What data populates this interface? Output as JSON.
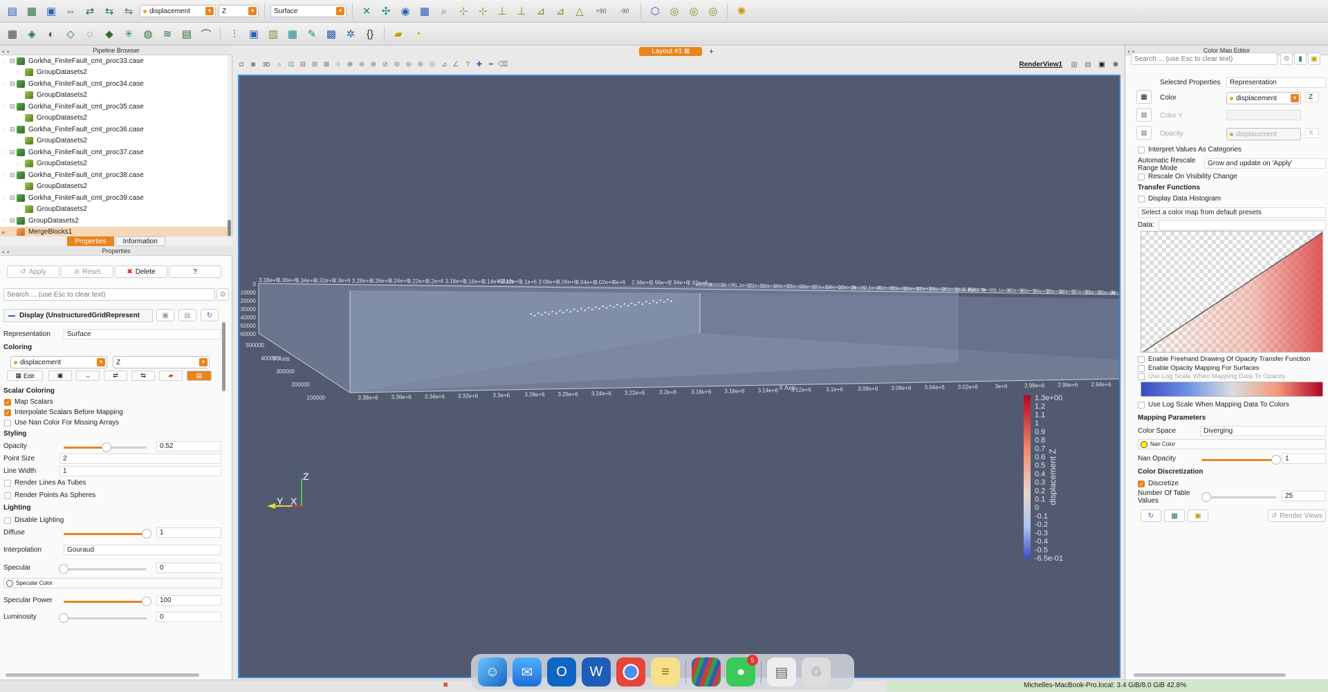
{
  "toolbar1": {
    "color_array": "displacement",
    "component": "Z",
    "representation": "Surface",
    "rot_plus": "+90",
    "rot_minus": "-90"
  },
  "pipeline": {
    "title": "Pipeline Browser",
    "items": [
      {
        "label": "Gorkha_FiniteFault_cmt_proc33.case",
        "kind": "case"
      },
      {
        "label": "GroupDatasets2",
        "kind": "group"
      },
      {
        "label": "Gorkha_FiniteFault_cmt_proc34.case",
        "kind": "case"
      },
      {
        "label": "GroupDatasets2",
        "kind": "group"
      },
      {
        "label": "Gorkha_FiniteFault_cmt_proc35.case",
        "kind": "case"
      },
      {
        "label": "GroupDatasets2",
        "kind": "group"
      },
      {
        "label": "Gorkha_FiniteFault_cmt_proc36.case",
        "kind": "case"
      },
      {
        "label": "GroupDatasets2",
        "kind": "group"
      },
      {
        "label": "Gorkha_FiniteFault_cmt_proc37.case",
        "kind": "case"
      },
      {
        "label": "GroupDatasets2",
        "kind": "group"
      },
      {
        "label": "Gorkha_FiniteFault_cmt_proc38.case",
        "kind": "case"
      },
      {
        "label": "GroupDatasets2",
        "kind": "group"
      },
      {
        "label": "Gorkha_FiniteFault_cmt_proc39.case",
        "kind": "case"
      },
      {
        "label": "GroupDatasets2",
        "kind": "group"
      },
      {
        "label": "GroupDatasets2",
        "kind": "case"
      },
      {
        "label": "MergeBlocks1",
        "kind": "selected"
      }
    ]
  },
  "tabs": {
    "properties": "Properties",
    "information": "Information"
  },
  "properties": {
    "title": "Properties",
    "apply": "Apply",
    "reset": "Reset",
    "delete": "Delete",
    "help": "?",
    "search_placeholder": "Search ... (use Esc to clear text)",
    "display_header": "Display (UnstructuredGridRepresent",
    "representation_label": "Representation",
    "representation_value": "Surface",
    "coloring_section": "Coloring",
    "color_array": "displacement",
    "color_component": "Z",
    "edit": "Edit",
    "scalar_coloring_section": "Scalar Coloring",
    "map_scalars": "Map Scalars",
    "interpolate": "Interpolate Scalars Before Mapping",
    "nan_color_missing": "Use Nan Color For Missing Arrays",
    "styling_section": "Styling",
    "opacity_label": "Opacity",
    "opacity_value": "0.52",
    "opacity_level": 0.52,
    "point_size_label": "Point Size",
    "point_size_value": "2",
    "line_width_label": "Line Width",
    "line_width_value": "1",
    "lines_as_tubes": "Render Lines As Tubes",
    "points_as_spheres": "Render Points As Spheres",
    "lighting_section": "Lighting",
    "disable_lighting": "Disable Lighting",
    "diffuse_label": "Diffuse",
    "diffuse_value": "1",
    "diffuse_level": 1,
    "interpolation_label": "Interpolation",
    "interpolation_value": "Gouraud",
    "specular_label": "Specular",
    "specular_value": "0",
    "specular_level": 0,
    "specular_color": "Specular Color",
    "specular_power_label": "Specular Power",
    "specular_power_value": "100",
    "specular_power_level": 1,
    "luminosity_label": "Luminosity",
    "luminosity_value": "0",
    "luminosity_level": 0
  },
  "layout": {
    "tab": "Layout #1",
    "add": "+",
    "view_name": "RenderView1",
    "mode_3d": "3D"
  },
  "viewport": {
    "y_axis_title": "Y Axis",
    "x_axis_title": "X Axis",
    "x_axis_title_front": "X Axis",
    "y_axis_title_side": "Y Axis",
    "top_back_ticks": [
      "3.38e+6",
      "3.36e+6",
      "3.34e+6",
      "3.32e+6",
      "3.3e+6",
      "3.28e+6",
      "3.26e+6",
      "3.24e+6",
      "3.22e+6",
      "3.2e+6",
      "3.18e+6",
      "3.16e+6",
      "3.14e+6",
      "3.12e+6",
      "3.1e+6",
      "3.08e+6",
      "3.06e+6",
      "3.04e+6",
      "3.02e+6",
      "3e+6",
      "2.98e+6",
      "2.96e+6",
      "2.94e+6",
      "2.92e+6"
    ],
    "top_right_ticks": [
      "800000",
      "900000",
      "1e+06",
      "1.1e+06",
      "1.2e+06",
      "1.3e+06",
      "1.4e+06",
      "1.5e+06",
      "1.6e+06",
      "1.7e+06",
      "1.8e+06",
      "1.9e+06",
      "2e+06",
      "2.1e+06",
      "2.2e+06",
      "2.3e+06",
      "2.4e+06",
      "2.5e+06",
      "2.6e+06",
      "2.7e+06",
      "2.8e+06",
      "2.9e+06",
      "3e+06",
      "3.1e+06",
      "3.2e+06",
      "3.3e+06",
      "3.4e+06",
      "3.5e+06",
      "3.6e+06",
      "3.7e+06",
      "3.8e+06",
      "3.9e+06",
      "4e+06"
    ],
    "z_ticks": [
      "0",
      "-10000",
      "-20000",
      "-30000",
      "-40000",
      "-50000",
      "-60000"
    ],
    "x_side_ticks": [
      "500000",
      "400000",
      "300000",
      "200000",
      "100000"
    ],
    "front_ticks": [
      "3.38e+6",
      "3.36e+6",
      "3.34e+6",
      "3.32e+6",
      "3.3e+6",
      "3.28e+6",
      "3.26e+6",
      "3.24e+6",
      "3.22e+6",
      "3.2e+6",
      "3.18e+6",
      "3.16e+6",
      "3.14e+6",
      "3.12e+6",
      "3.1e+6",
      "3.08e+6",
      "3.06e+6",
      "3.04e+6",
      "3.02e+6",
      "3e+6",
      "2.98e+6",
      "2.96e+6",
      "2.94e+6"
    ],
    "orient_z": "Z",
    "orient_y": "Y",
    "orient_x": "X",
    "colorbar_title": "displacement Z",
    "colorbar_labels": [
      "1.3e+00",
      "1.2",
      "1.1",
      "1",
      "0.9",
      "0.8",
      "0.7",
      "0.6",
      "0.5",
      "0.4",
      "0.3",
      "0.2",
      "0.1",
      "0",
      "-0.1",
      "-0.2",
      "-0.3",
      "-0.4",
      "-0.5",
      "-6.5e-01"
    ]
  },
  "colormap": {
    "title": "Color Map Editor",
    "search_placeholder": "Search ... (use Esc to clear text)",
    "selected_properties_label": "Selected Properties",
    "selected_properties_value": "Representation",
    "color_label": "Color",
    "color_value": "displacement",
    "color_component": "Z",
    "color_y_label": "Color Y",
    "opacity_label": "Opacity",
    "opacity_value": "displacement",
    "opacity_component": "X",
    "interpret_categories": "Interpret Values As Categories",
    "auto_rescale_label": "Automatic Rescale Range Mode",
    "auto_rescale_value": "Grow and update on 'Apply'",
    "rescale_visibility": "Rescale On Visibility Change",
    "transfer_functions": "Transfer Functions",
    "display_histogram": "Display Data Histogram",
    "preset_button": "Select a color map from default presets",
    "data_label": "Data:",
    "freehand": "Enable Freehand Drawing Of Opacity Transfer Function",
    "opacity_surfaces": "Enable Opacity Mapping For Surfaces",
    "log_opacity": "Use Log Scale When Mapping Data To Opacity",
    "log_colors": "Use Log Scale When Mapping Data To Colors",
    "mapping_params": "Mapping Parameters",
    "color_space_label": "Color Space",
    "color_space_value": "Diverging",
    "nan_color": "Nan Color",
    "nan_opacity_label": "Nan Opacity",
    "nan_opacity_value": "1",
    "nan_opacity_level": 1,
    "discretization": "Color Discretization",
    "discretize": "Discretize",
    "table_values_label": "Number Of Table Values",
    "table_values_value": "25",
    "render_views": "Render Views"
  },
  "dock": {
    "messages_badge": "5"
  },
  "status": {
    "memory": "Michelles-MacBook-Pro.local: 3.4 GiB/8.0 GiB 42.8%"
  },
  "colors": {
    "accent": "#e8851c",
    "viewport_bg": "#525a70",
    "selection_border": "#3d85e0"
  }
}
